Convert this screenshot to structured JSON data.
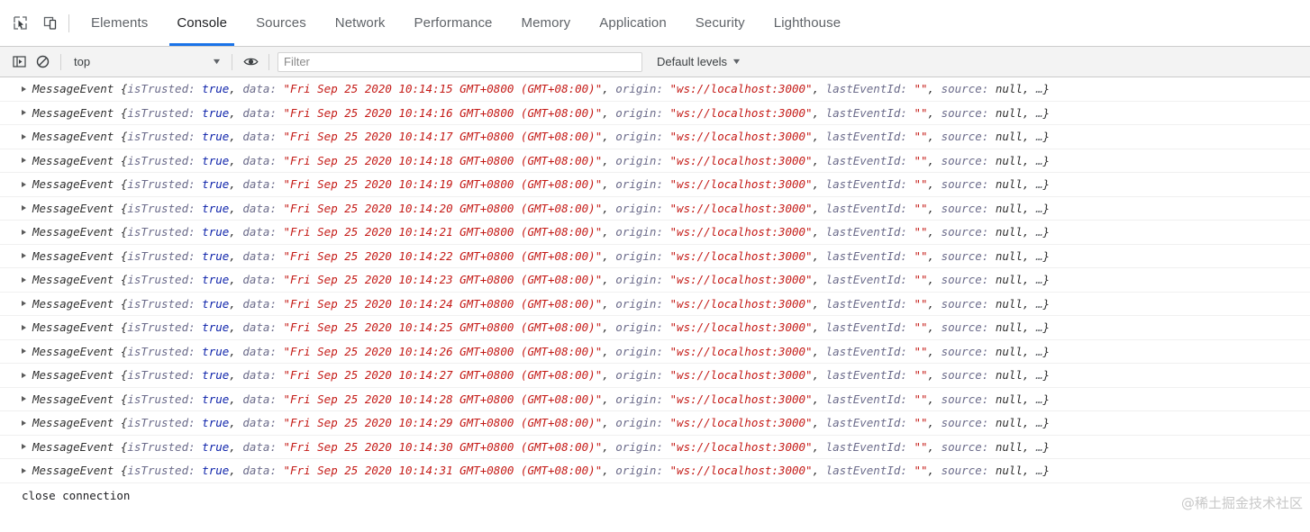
{
  "tabbar": {
    "icons": [
      {
        "name": "inspect-element-icon",
        "title": "Inspect element"
      },
      {
        "name": "device-toolbar-icon",
        "title": "Toggle device toolbar"
      }
    ],
    "tabs": [
      {
        "label": "Elements",
        "active": false
      },
      {
        "label": "Console",
        "active": true
      },
      {
        "label": "Sources",
        "active": false
      },
      {
        "label": "Network",
        "active": false
      },
      {
        "label": "Performance",
        "active": false
      },
      {
        "label": "Memory",
        "active": false
      },
      {
        "label": "Application",
        "active": false
      },
      {
        "label": "Security",
        "active": false
      },
      {
        "label": "Lighthouse",
        "active": false
      }
    ],
    "active_tab_accent": "#1a73e8"
  },
  "toolbar": {
    "sidebar_toggle": "show-console-sidebar-icon",
    "clear_console": "clear-console-icon",
    "context_value": "top",
    "context_caret": "▼",
    "live_expression": "eye-icon",
    "filter_placeholder": "Filter",
    "filter_value": "",
    "levels_label": "Default levels",
    "levels_caret": "▼"
  },
  "console": {
    "expand_arrow": "▶",
    "class_name": "MessageEvent",
    "open_brace": "{",
    "close_brace": "}",
    "prop_is_trusted": "isTrusted:",
    "value_is_trusted": "true",
    "prop_data": "data:",
    "prop_origin": "origin:",
    "value_origin": "\"ws://localhost:3000\"",
    "prop_last_event_id": "lastEventId:",
    "value_last_event_id": "\"\"",
    "prop_source": "source:",
    "value_source": "null",
    "ellipsis": "…",
    "comma": ",",
    "rows": [
      {
        "data": "\"Fri Sep 25 2020 10:14:15 GMT+0800 (GMT+08:00)\""
      },
      {
        "data": "\"Fri Sep 25 2020 10:14:16 GMT+0800 (GMT+08:00)\""
      },
      {
        "data": "\"Fri Sep 25 2020 10:14:17 GMT+0800 (GMT+08:00)\""
      },
      {
        "data": "\"Fri Sep 25 2020 10:14:18 GMT+0800 (GMT+08:00)\""
      },
      {
        "data": "\"Fri Sep 25 2020 10:14:19 GMT+0800 (GMT+08:00)\""
      },
      {
        "data": "\"Fri Sep 25 2020 10:14:20 GMT+0800 (GMT+08:00)\""
      },
      {
        "data": "\"Fri Sep 25 2020 10:14:21 GMT+0800 (GMT+08:00)\""
      },
      {
        "data": "\"Fri Sep 25 2020 10:14:22 GMT+0800 (GMT+08:00)\""
      },
      {
        "data": "\"Fri Sep 25 2020 10:14:23 GMT+0800 (GMT+08:00)\""
      },
      {
        "data": "\"Fri Sep 25 2020 10:14:24 GMT+0800 (GMT+08:00)\""
      },
      {
        "data": "\"Fri Sep 25 2020 10:14:25 GMT+0800 (GMT+08:00)\""
      },
      {
        "data": "\"Fri Sep 25 2020 10:14:26 GMT+0800 (GMT+08:00)\""
      },
      {
        "data": "\"Fri Sep 25 2020 10:14:27 GMT+0800 (GMT+08:00)\""
      },
      {
        "data": "\"Fri Sep 25 2020 10:14:28 GMT+0800 (GMT+08:00)\""
      },
      {
        "data": "\"Fri Sep 25 2020 10:14:29 GMT+0800 (GMT+08:00)\""
      },
      {
        "data": "\"Fri Sep 25 2020 10:14:30 GMT+0800 (GMT+08:00)\""
      },
      {
        "data": "\"Fri Sep 25 2020 10:14:31 GMT+0800 (GMT+08:00)\""
      }
    ],
    "footer_message": "close connection"
  },
  "watermark": {
    "text": "@稀土掘金技术社区"
  },
  "colors": {
    "string": "#c41a16",
    "boolean": "#0d22aa",
    "property": "#6b6b8a",
    "accent": "#1a73e8",
    "toolbar_bg": "#f3f3f3"
  }
}
